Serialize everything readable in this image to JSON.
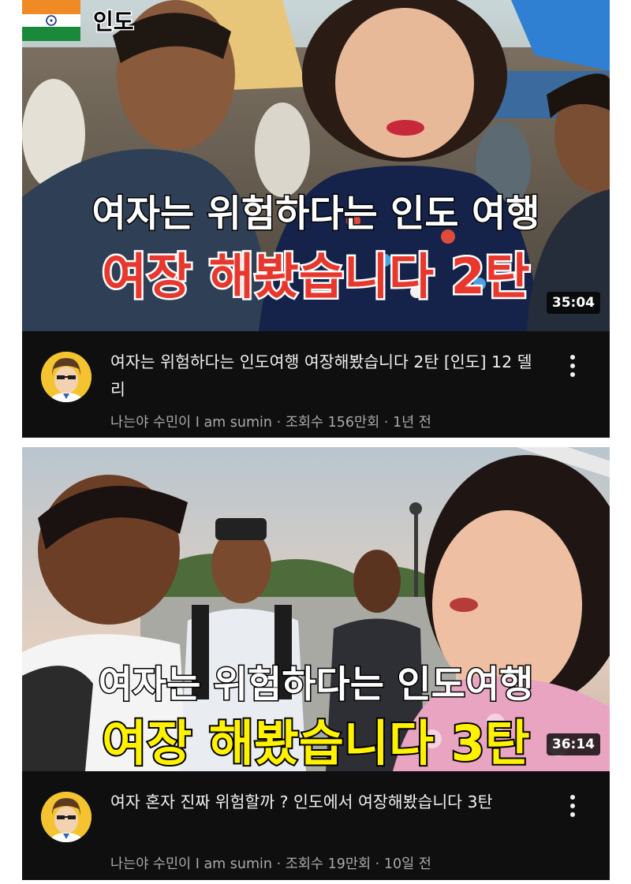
{
  "videos": [
    {
      "country_badge": "인도",
      "caption_line1": "여자는 위험하다는 인도 여행",
      "caption_line2": "여장 해봤습니다 2탄",
      "duration": "35:04",
      "title": "여자는 위험하다는 인도여행 여장해봤습니다 2탄 [인도] 12 델리",
      "channel": "나는야 수민이 I am sumin",
      "views": "조회수 156만회",
      "age": "1년 전",
      "menu_icon": "more-vert-icon"
    },
    {
      "caption_line1": "여자는 위험하다는 인도여행",
      "caption_line2": "여장 해봤습니다 3탄",
      "duration": "36:14",
      "title": "여자 혼자 진짜 위험할까 ? 인도에서 여장해봤습니다 3탄",
      "channel": "나는야 수민이 I am sumin",
      "views": "조회수 19만회",
      "age": "10일 전",
      "menu_icon": "more-vert-icon"
    }
  ],
  "separator": "·",
  "colors": {
    "card_bg": "#0f0f0f",
    "title_text": "#f1f1f1",
    "meta_text": "#aaaaaa",
    "caption_red": "#e8372c",
    "caption_yellow": "#fff200"
  }
}
